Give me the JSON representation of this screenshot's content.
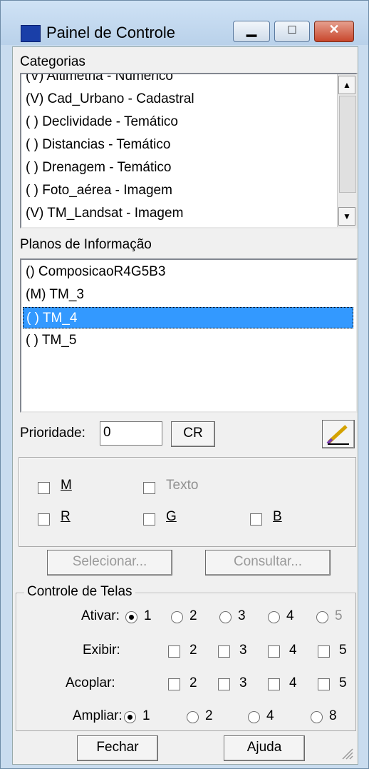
{
  "window": {
    "title": "Painel de Controle"
  },
  "categorias": {
    "label": "Categorias",
    "items": [
      "(V) Altimetria - Numérico",
      "(V) Cad_Urbano - Cadastral",
      "( ) Declividade - Temático",
      "( ) Distancias - Temático",
      "( ) Drenagem - Temático",
      "( ) Foto_aérea - Imagem",
      "(V) TM_Landsat - Imagem"
    ]
  },
  "planos": {
    "label": "Planos de Informação",
    "items": [
      "() ComposicaoR4G5B3",
      "(M) TM_3",
      "( ) TM_4",
      "( ) TM_5"
    ]
  },
  "prioridade": {
    "label": "Prioridade:",
    "value": "0",
    "cr_label": "CR"
  },
  "bands": {
    "m": "M",
    "texto": "Texto",
    "r": "R",
    "g": "G",
    "b": "B"
  },
  "actions": {
    "selecionar": "Selecionar...",
    "consultar": "Consultar..."
  },
  "telas": {
    "title": "Controle de Telas",
    "ativar": {
      "label": "Ativar:",
      "options": [
        "1",
        "2",
        "3",
        "4",
        "5"
      ]
    },
    "exibir": {
      "label": "Exibir:",
      "options": [
        "2",
        "3",
        "4",
        "5"
      ]
    },
    "acoplar": {
      "label": "Acoplar:",
      "options": [
        "2",
        "3",
        "4",
        "5"
      ]
    },
    "ampliar": {
      "label": "Ampliar:",
      "options": [
        "1",
        "2",
        "4",
        "8"
      ]
    }
  },
  "footer": {
    "fechar": "Fechar",
    "ajuda": "Ajuda"
  }
}
